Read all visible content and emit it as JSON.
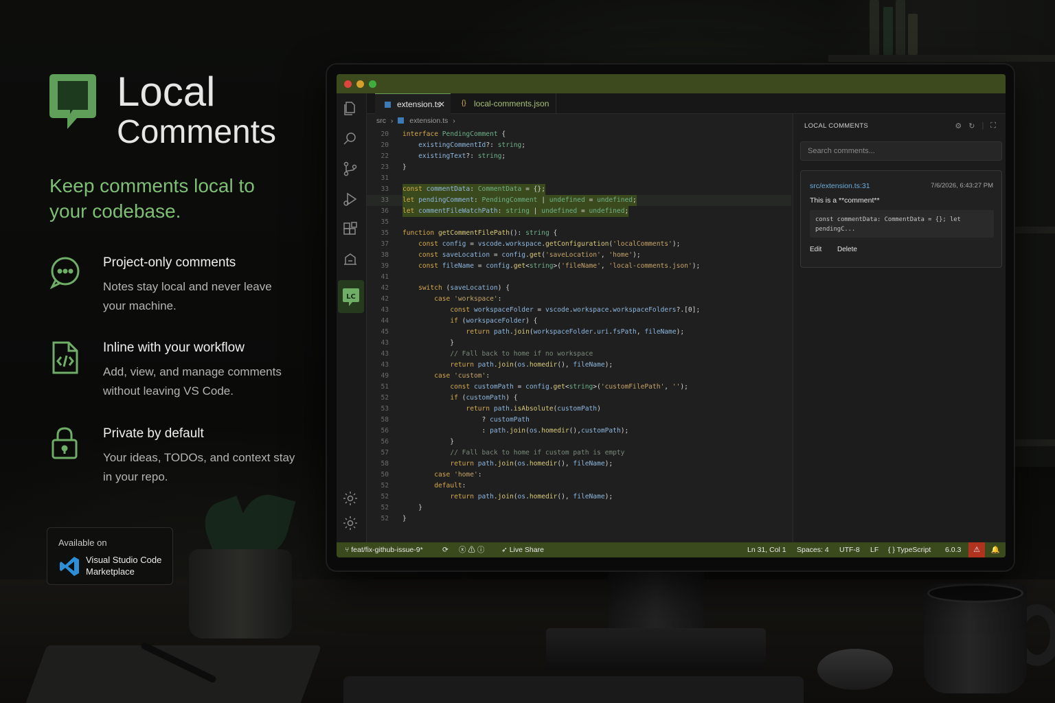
{
  "brand": {
    "title_line1": "Local",
    "title_line2": "Comments",
    "tagline": "Keep comments local to your codebase."
  },
  "features": [
    {
      "title": "Project-only comments",
      "desc": "Notes stay local and never leave your machine.",
      "icon": "chat-bubble-icon"
    },
    {
      "title": "Inline with your workflow",
      "desc": "Add, view, and manage comments without leaving VS Code.",
      "icon": "code-file-icon"
    },
    {
      "title": "Private by default",
      "desc": "Your ideas, TODOs, and context stay in your repo.",
      "icon": "lock-icon"
    }
  ],
  "badge": {
    "available": "Available on",
    "marketplace_line1": "Visual Studio Code",
    "marketplace_line2": "Marketplace"
  },
  "colors": {
    "accent": "#7fbf74",
    "titlebar": "#3c4a1d",
    "statusbar": "#3b4a1d"
  },
  "editor": {
    "tabs": [
      {
        "label": "extension.ts",
        "close": "✕"
      },
      {
        "label": "local-comments.json"
      }
    ],
    "breadcrumb": {
      "folder": "src",
      "file": "extension.ts"
    },
    "lines": [
      {
        "n": "20",
        "text": "interface PendingComment {"
      },
      {
        "n": "20",
        "text": "    existingCommentId?: string;"
      },
      {
        "n": "22",
        "text": "    existingText?: string;"
      },
      {
        "n": "23",
        "text": "}"
      },
      {
        "n": "31",
        "text": ""
      },
      {
        "n": "33",
        "text": "const commentData: CommentData = {};"
      },
      {
        "n": "33",
        "text": "let pendingComment: PendingComment | undefined = undefined;"
      },
      {
        "n": "36",
        "text": "let commentFileWatchPath: string | undefined = undefined;"
      },
      {
        "n": "35",
        "text": ""
      },
      {
        "n": "35",
        "text": "function getCommentFilePath(): string {"
      },
      {
        "n": "37",
        "text": "    const config = vscode.workspace.getConfiguration('localComments');"
      },
      {
        "n": "38",
        "text": "    const saveLocation = config.get('saveLocation', 'home');"
      },
      {
        "n": "39",
        "text": "    const fileName = config.get<string>('fileName', 'local-comments.json');"
      },
      {
        "n": "41",
        "text": ""
      },
      {
        "n": "42",
        "text": "    switch (saveLocation) {"
      },
      {
        "n": "42",
        "text": "        case 'workspace':"
      },
      {
        "n": "43",
        "text": "            const workspaceFolder = vscode.workspace.workspaceFolders?.[0];"
      },
      {
        "n": "44",
        "text": "            if (workspaceFolder) {"
      },
      {
        "n": "45",
        "text": "                return path.join(workspaceFolder.uri.fsPath, fileName);"
      },
      {
        "n": "43",
        "text": "            }"
      },
      {
        "n": "43",
        "text": "            // Fall back to home if no workspace"
      },
      {
        "n": "43",
        "text": "            return path.join(os.homedir(), fileName);"
      },
      {
        "n": "49",
        "text": "        case 'custom':"
      },
      {
        "n": "51",
        "text": "            const customPath = config.get<string>('customFilePath', '');"
      },
      {
        "n": "52",
        "text": "            if (customPath) {"
      },
      {
        "n": "53",
        "text": "                return path.isAbsolute(customPath)"
      },
      {
        "n": "58",
        "text": "                    ? customPath"
      },
      {
        "n": "56",
        "text": "                    : path.join(os.homedir(),customPath);"
      },
      {
        "n": "56",
        "text": "            }"
      },
      {
        "n": "57",
        "text": "            // Fall back to home if custom path is empty"
      },
      {
        "n": "58",
        "text": "            return path.join(os.homedir(), fileName);"
      },
      {
        "n": "50",
        "text": "        case 'home':"
      },
      {
        "n": "52",
        "text": "        default:"
      },
      {
        "n": "52",
        "text": "            return path.join(os.homedir(), fileName);"
      },
      {
        "n": "52",
        "text": "    }"
      },
      {
        "n": "52",
        "text": "}"
      }
    ]
  },
  "panel": {
    "title": "LOCAL COMMENTS",
    "search_placeholder": "Search comments...",
    "comment": {
      "file": "src/extension.ts:31",
      "date": "7/6/2026, 6:43:27 PM",
      "body": "This is a **comment**",
      "snippet": "const commentData: CommentData = {}; let pendingC...",
      "edit": "Edit",
      "delete": "Delete"
    }
  },
  "status": {
    "branch": "feat/fix-github-issue-9*",
    "live_share": "Live Share",
    "position": "Ln 31, Col 1",
    "spaces": "Spaces: 4",
    "encoding": "UTF-8",
    "eol": "LF",
    "language": "{ } TypeScript",
    "version": "6.0.3"
  }
}
